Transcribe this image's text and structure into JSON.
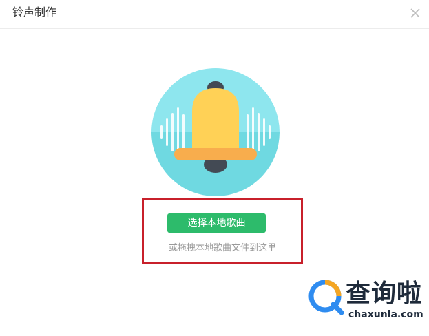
{
  "dialog": {
    "title": "铃声制作"
  },
  "main": {
    "select_button_label": "选择本地歌曲",
    "drag_hint": "或拖拽本地歌曲文件到这里"
  },
  "watermark": {
    "name": "查询啦",
    "domain": "chaxunla.com"
  },
  "icons": {
    "close": "close-icon",
    "bell": "bell-icon",
    "logo": "magnifier-logo-icon"
  },
  "colors": {
    "button": "#2dbb6b",
    "highlight": "#c8202b",
    "bell_body": "#ffd156",
    "bell_rim": "#f8ad4d",
    "circle_top": "#8ee6ee",
    "circle_bottom": "#6fd9e1"
  }
}
